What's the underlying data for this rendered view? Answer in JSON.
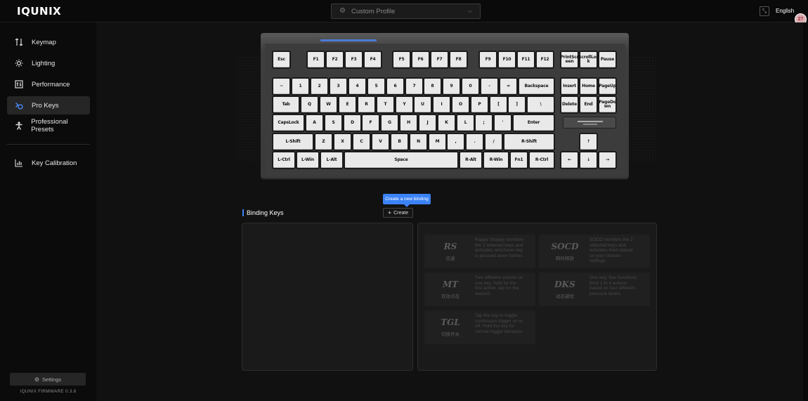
{
  "app": {
    "logo": "IQUNIX",
    "profile": "Custom Profile",
    "language": "English",
    "avatar": "27"
  },
  "sidebar": {
    "items": [
      {
        "label": "Keymap",
        "icon": "keymap-icon",
        "active": false
      },
      {
        "label": "Lighting",
        "icon": "sun-icon",
        "active": false
      },
      {
        "label": "Performance",
        "icon": "performance-icon",
        "active": false
      },
      {
        "label": "Pro Keys",
        "icon": "pro-keys-icon",
        "active": true
      },
      {
        "label": "Professional Presets",
        "icon": "person-icon",
        "active": false
      },
      {
        "label": "Key Calibration",
        "icon": "bar-chart-icon",
        "active": false
      }
    ],
    "settings_label": "Settings",
    "firmware": "IQUNIX FIRMWARE 0.3.6"
  },
  "keyboard": {
    "rows": [
      [
        "Esc",
        "F1",
        "F2",
        "F3",
        "F4",
        "F5",
        "F6",
        "F7",
        "F8",
        "F9",
        "F10",
        "F11",
        "F12",
        "PrintScr een",
        "ScrollLoc k",
        "Pause"
      ],
      [
        "~",
        "1",
        "2",
        "3",
        "4",
        "5",
        "6",
        "7",
        "8",
        "9",
        "0",
        "-",
        "=",
        "Backspace",
        "Insert",
        "Home",
        "PageUp"
      ],
      [
        "Tab",
        "Q",
        "W",
        "E",
        "R",
        "T",
        "Y",
        "U",
        "I",
        "O",
        "P",
        "[",
        "]",
        "\\",
        "Delete",
        "End",
        "PageDo wn"
      ],
      [
        "CapsLock",
        "A",
        "S",
        "D",
        "F",
        "G",
        "H",
        "J",
        "K",
        "L",
        ";",
        "'",
        "Enter"
      ],
      [
        "L-Shift",
        "Z",
        "X",
        "C",
        "V",
        "B",
        "N",
        "M",
        ",",
        ".",
        "/",
        "R-Shift",
        "↑"
      ],
      [
        "L-Ctrl",
        "L-Win",
        "L-Alt",
        "Space",
        "R-Alt",
        "R-Win",
        "Fn1",
        "R-Ctrl",
        "←",
        "↓",
        "→"
      ]
    ]
  },
  "binding": {
    "tooltip": "Create a new binding",
    "title": "Binding Keys",
    "create_label": "Create",
    "cards": [
      {
        "abbr": "RS",
        "cn": "迅速",
        "desc": "Rappy Snappy monitors the 2 selected keys and activates whichever key is pressed down further."
      },
      {
        "abbr": "SOCD",
        "cn": "瞬时释放",
        "desc": "SOCD monitors the 2 selected keys and activates them based on your chosen settings."
      },
      {
        "abbr": "MT",
        "cn": "双效点击",
        "desc": "Two different actions on one key: hold for the first action, tap for the second."
      },
      {
        "abbr": "DKS",
        "cn": "动态键程",
        "desc": "One key, four functions: Bind 1 to 4 actions based on four different pressure levels."
      },
      {
        "abbr": "TGL",
        "cn": "切换开关",
        "desc": "Tap the key to toggle continuous trigger on or off. Hold the key for normal trigger behavior."
      }
    ]
  }
}
